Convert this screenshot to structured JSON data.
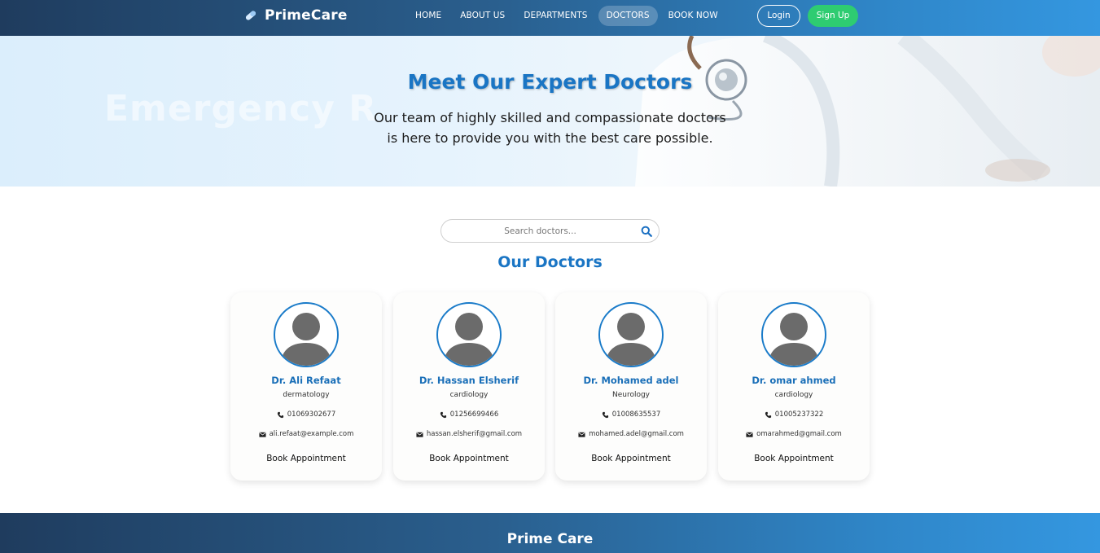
{
  "nav": {
    "brand": "PrimeCare",
    "links": [
      "HOME",
      "ABOUT US",
      "DEPARTMENTS",
      "DOCTORS",
      "BOOK NOW"
    ],
    "active": "DOCTORS",
    "login": "Login",
    "signup": "Sign Up"
  },
  "hero": {
    "title": "Meet Our Expert Doctors",
    "subtitle_line1": "Our team of highly skilled and compassionate doctors",
    "subtitle_line2": "is here to provide you with the best care possible.",
    "background_text": "Emergency R"
  },
  "search": {
    "placeholder": "Search doctors..."
  },
  "section": {
    "title": "Our Doctors"
  },
  "doctors": [
    {
      "name": "Dr. Ali Refaat",
      "department": "dermatology",
      "phone": "01069302677",
      "email": "ali.refaat@example.com",
      "action": "Book Appointment"
    },
    {
      "name": "Dr. Hassan Elsherif",
      "department": "cardiology",
      "phone": "01256699466",
      "email": "hassan.elsherif@gmail.com",
      "action": "Book Appointment"
    },
    {
      "name": "Dr. Mohamed adel",
      "department": "Neurology",
      "phone": "01008635537",
      "email": "mohamed.adel@gmail.com",
      "action": "Book Appointment"
    },
    {
      "name": "Dr. omar ahmed",
      "department": "cardiology",
      "phone": "01005237322",
      "email": "omarahmed@gmail.com",
      "action": "Book Appointment"
    }
  ],
  "footer": {
    "title": "Prime Care"
  },
  "colors": {
    "accent": "#1a75c4",
    "signup": "#2ecc71",
    "nav_dark": "#1f3c5e",
    "nav_light": "#3497e0"
  },
  "icons": {
    "brand": "pill-icon",
    "search": "search-icon",
    "phone": "phone-icon",
    "email": "envelope-icon",
    "avatar": "user-silhouette-icon"
  }
}
